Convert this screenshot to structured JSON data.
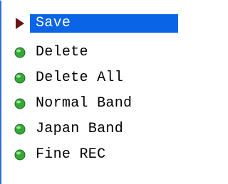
{
  "menu": {
    "items": [
      {
        "label": "Save",
        "icon": "play-arrow-icon",
        "selected": true
      },
      {
        "label": "Delete",
        "icon": "green-bullet-icon",
        "selected": false
      },
      {
        "label": "Delete All",
        "icon": "green-bullet-icon",
        "selected": false
      },
      {
        "label": "Normal Band",
        "icon": "green-bullet-icon",
        "selected": false
      },
      {
        "label": "Japan Band",
        "icon": "green-bullet-icon",
        "selected": false
      },
      {
        "label": "Fine REC",
        "icon": "green-bullet-icon",
        "selected": false
      }
    ]
  },
  "colors": {
    "selection": "#0a64e6",
    "arrow": "#6b1414",
    "bullet": "#35a835",
    "frame": "#2f6bd8"
  }
}
